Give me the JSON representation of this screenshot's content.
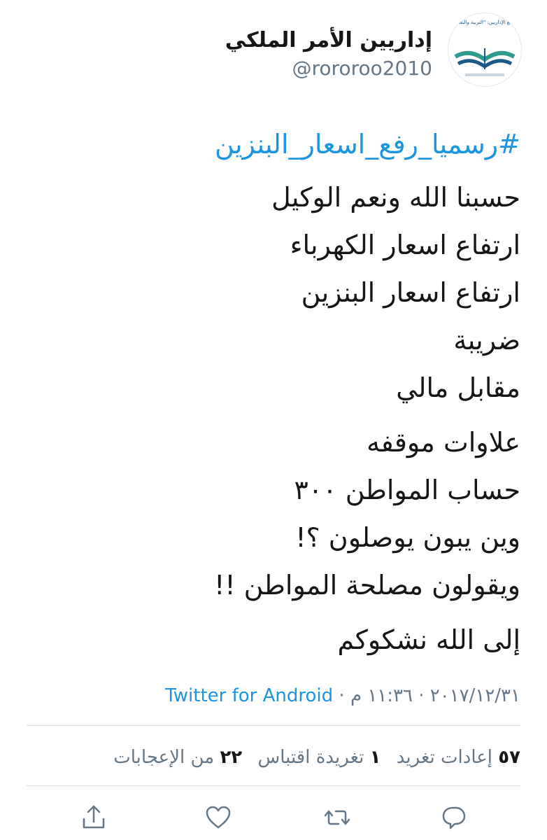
{
  "tweet": {
    "display_name": "إداريين الأمر الملكي",
    "handle": "@rororoo2010",
    "avatar_caption": "تجمع الإداريين: \"التربية والتعليم\" في تنفيذ الأمر الملكي بحقنا",
    "hashtag": "#رسميا_رفع_اسعار_البنزين",
    "lines": [
      "حسبنا الله ونعم الوكيل",
      "ارتفاع اسعار الكهرباء",
      "ارتفاع اسعار البنزين",
      "ضريبة",
      "مقابل مالي",
      "علاوات موقفه",
      "حساب المواطن ٣٠٠",
      "وين يبون يوصلون ؟!",
      "ويقولون مصلحة المواطن !!",
      "إلى الله نشكوكم"
    ],
    "date": "٢٠١٧/١٢/٣١",
    "time": "١١:٣٦ م",
    "dot": "·",
    "source": "Twitter for Android"
  },
  "stats": {
    "retweets_count": "٥٧",
    "retweets_label": "إعادات تغريد",
    "quotes_count": "١",
    "quotes_label": "تغريدة اقتباس",
    "likes_count": "٢٢",
    "likes_label": "من الإعجابات"
  },
  "colors": {
    "link": "#1b95e0",
    "text": "#14171a",
    "muted": "#657786",
    "icon": "#657786"
  },
  "actions": [
    "reply-icon",
    "retweet-icon",
    "like-icon",
    "share-icon"
  ]
}
